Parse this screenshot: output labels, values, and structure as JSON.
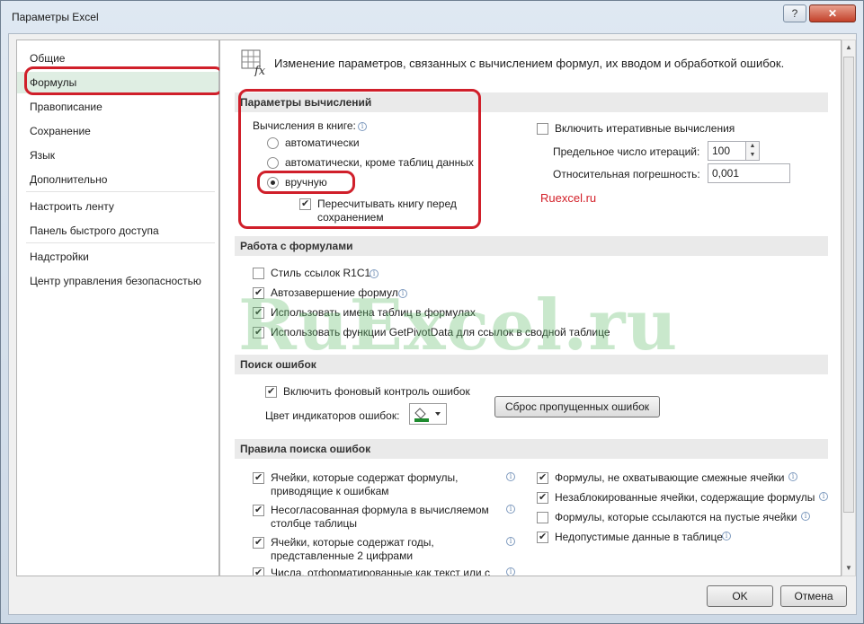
{
  "window": {
    "title": "Параметры Excel",
    "help_label": "?",
    "close_label": "✕"
  },
  "sidebar": {
    "items": [
      {
        "label": "Общие"
      },
      {
        "label": "Формулы",
        "selected": true
      },
      {
        "label": "Правописание"
      },
      {
        "label": "Сохранение"
      },
      {
        "label": "Язык"
      },
      {
        "label": "Дополнительно"
      },
      {
        "label": "Настроить ленту"
      },
      {
        "label": "Панель быстрого доступа"
      },
      {
        "label": "Надстройки"
      },
      {
        "label": "Центр управления безопасностью"
      }
    ]
  },
  "header": {
    "icon": "formula-sheet-icon",
    "text": "Изменение параметров, связанных с вычислением формул, их вводом и обработкой ошибок."
  },
  "calc": {
    "section_title": "Параметры вычислений",
    "workbook_label": "Вычисления в книге:",
    "radio_auto": "автоматически",
    "radio_auto_except": "автоматически, кроме таблиц данных",
    "radio_manual": "вручную",
    "selected_mode": "вручную",
    "recalc_before_save_line1": "Пересчитывать книгу перед",
    "recalc_before_save_line2": "сохранением",
    "recalc_before_save_checked": true,
    "iterative_label": "Включить итеративные вычисления",
    "iterative_checked": false,
    "max_iterations_label": "Предельное число итераций:",
    "max_iterations_value": "100",
    "max_change_label": "Относительная погрешность:",
    "max_change_value": "0,001"
  },
  "watermark_link": "Ruexcel.ru",
  "watermark_big": "RuExcel.ru",
  "formulas": {
    "section_title": "Работа с формулами",
    "items": [
      {
        "label": "Стиль ссылок R1C1",
        "checked": false,
        "info": true
      },
      {
        "label": "Автозавершение формул",
        "checked": true,
        "info": true
      },
      {
        "label": "Использовать имена таблиц в формулах",
        "checked": true,
        "info": false
      },
      {
        "label": "Использовать функции GetPivotData для ссылок в сводной таблице",
        "checked": true,
        "info": false
      }
    ]
  },
  "errors": {
    "section_title": "Поиск ошибок",
    "background_check_label": "Включить фоновый контроль ошибок",
    "background_check_checked": true,
    "indicator_color_label": "Цвет индикаторов ошибок:",
    "indicator_color": "#1e8b2f",
    "reset_button": "Сброс пропущенных ошибок"
  },
  "rules": {
    "section_title": "Правила поиска ошибок",
    "left": [
      {
        "line1": "Ячейки, которые содержат формулы,",
        "line2": "приводящие к ошибкам",
        "checked": true
      },
      {
        "line1": "Несогласованная формула в вычисляемом",
        "line2": "столбце таблицы",
        "checked": true
      },
      {
        "line1": "Ячейки, которые содержат годы,",
        "line2": "представленные 2 цифрами",
        "checked": true
      },
      {
        "line1": "Числа, отформатированные как текст или с",
        "line2": "",
        "checked": true
      }
    ],
    "right": [
      {
        "label": "Формулы, не охватывающие смежные ячейки",
        "checked": true
      },
      {
        "label": "Незаблокированные ячейки, содержащие формулы",
        "checked": true
      },
      {
        "label": "Формулы, которые ссылаются на пустые ячейки",
        "checked": false
      },
      {
        "label": "Недопустимые данные в таблице",
        "checked": true
      }
    ]
  },
  "footer": {
    "ok": "OK",
    "cancel": "Отмена"
  },
  "colors": {
    "highlight_oval": "#d01f2a",
    "selected_nav": "#dfeee3",
    "section_bg": "#eaeaea"
  }
}
